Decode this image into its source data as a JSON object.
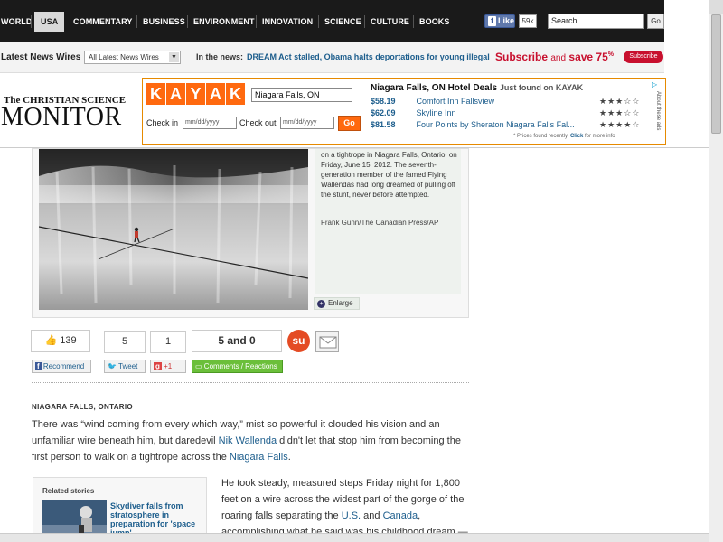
{
  "nav": {
    "items": [
      "WORLD",
      "USA",
      "COMMENTARY",
      "BUSINESS",
      "ENVIRONMENT",
      "INNOVATION",
      "SCIENCE",
      "CULTURE",
      "BOOKS"
    ],
    "active": "USA",
    "like_label": "Like",
    "like_count": "59k",
    "search_value": "Search",
    "search_button": "Go"
  },
  "wirebar": {
    "label": "Latest News Wires",
    "select_value": "All Latest News Wires",
    "news_label": "In the news:",
    "news_link": "DREAM Act stalled, Obama halts deportations for young illegal",
    "promo_subscribe": "Subscribe",
    "promo_and": "and",
    "promo_save": "save 75",
    "promo_pct": "%",
    "subscribe_button": "Subscribe"
  },
  "logo": {
    "top": "The CHRISTIAN SCIENCE",
    "main": "MONITOR"
  },
  "ad": {
    "logo": [
      "K",
      "A",
      "Y",
      "A",
      "K"
    ],
    "city_value": "Niagara Falls, ON",
    "checkin_label": "Check in",
    "checkout_label": "Check out",
    "date_placeholder": "mm/dd/yyyy",
    "go_button": "Go",
    "title": "Niagara Falls, ON Hotel Deals",
    "title_sub": "Just found on KAYAK",
    "hotels": [
      {
        "price": "$58.19",
        "name": "Comfort Inn Fallsview",
        "stars": "★★★☆☆"
      },
      {
        "price": "$62.09",
        "name": "Skyline Inn",
        "stars": "★★★☆☆"
      },
      {
        "price": "$81.58",
        "name": "Four Points by Sheraton Niagara Falls Fal...",
        "stars": "★★★★☆"
      }
    ],
    "footnote": "* Prices found recently.",
    "footnote_click": "Click",
    "footnote_end": "for more info",
    "about": "About these ads"
  },
  "photo": {
    "caption": "on a tightrope in Niagara Falls, Ontario, on Friday, June 15, 2012. The seventh-generation member of the famed Flying Wallendas had long dreamed of pulling off the stunt, never before attempted.",
    "credit": "Frank Gunn/The Canadian Press/AP",
    "enlarge": "Enlarge"
  },
  "social": {
    "likes": "139",
    "count_a": "5",
    "count_b": "1",
    "score": "5 and 0",
    "stumble": "su",
    "recommend": "Recommend",
    "tweet": "Tweet",
    "plusone": "+1",
    "comments": "Comments / Reactions"
  },
  "article": {
    "dateline": "NIAGARA FALLS, ONTARIO",
    "p1_a": "There was “wind coming from every which way,” mist so powerful it clouded his vision and an unfamiliar wire beneath him, but daredevil ",
    "p1_link1": "Nik Wallenda",
    "p1_b": " didn't let that stop him from becoming the first person to walk on a tightrope across the ",
    "p1_link2": "Niagara Falls",
    "p1_c": ".",
    "p2_a": "He took steady, measured steps Friday night for 1,800 feet on a wire across the widest part of the gorge of the roaring falls separating the ",
    "p2_link1": "U.S.",
    "p2_and": " and ",
    "p2_link2": "Canada",
    "p2_b": ", accomplishing what he said was his childhood dream —"
  },
  "related": {
    "heading": "Related stories",
    "link": "Skydiver falls from stratosphere in preparation for 'space jump'"
  }
}
